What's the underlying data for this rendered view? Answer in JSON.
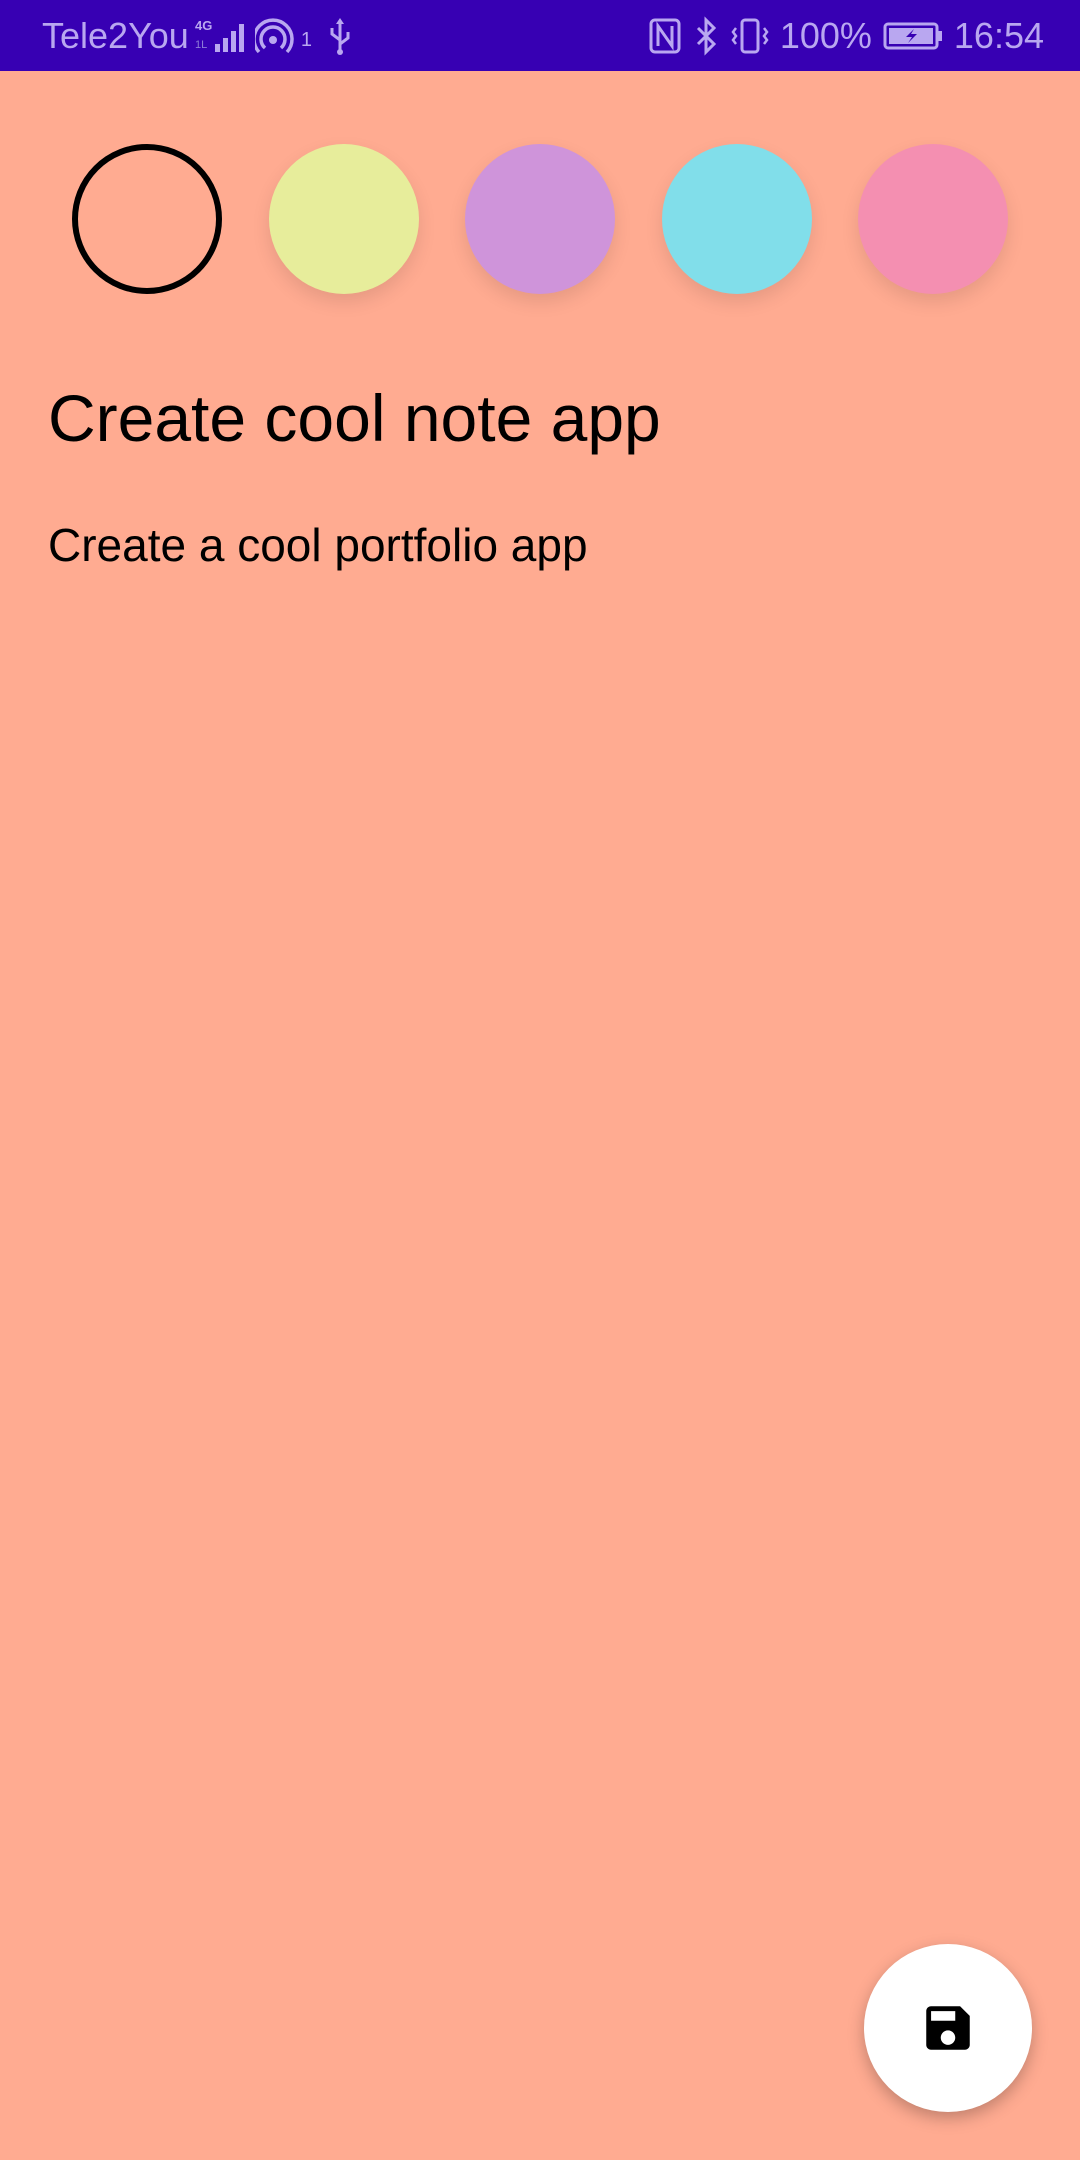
{
  "status_bar": {
    "carrier": "Tele2You",
    "network_type": "4G",
    "hotspot_count": "1",
    "battery": "100%",
    "time": "16:54",
    "background_color": "#3700B3",
    "text_color": "#B9A7F0",
    "icons": [
      "signal-icon",
      "hotspot-icon",
      "usb-icon",
      "nfc-icon",
      "bluetooth-icon",
      "vibrate-icon",
      "battery-charging-icon"
    ]
  },
  "editor": {
    "background_color": "#FFAB91",
    "colors": [
      {
        "name": "orange",
        "hex": "#FFAB91",
        "selected": true
      },
      {
        "name": "yellow",
        "hex": "#E7ED9B",
        "selected": false
      },
      {
        "name": "purple",
        "hex": "#CF94DA",
        "selected": false
      },
      {
        "name": "cyan",
        "hex": "#81DEEA",
        "selected": false
      },
      {
        "name": "pink",
        "hex": "#F48FB1",
        "selected": false
      }
    ],
    "title": "Create cool note app",
    "content": "Create a cool portfolio app"
  },
  "fab": {
    "icon": "save-icon",
    "background_color": "#FFFFFF"
  }
}
